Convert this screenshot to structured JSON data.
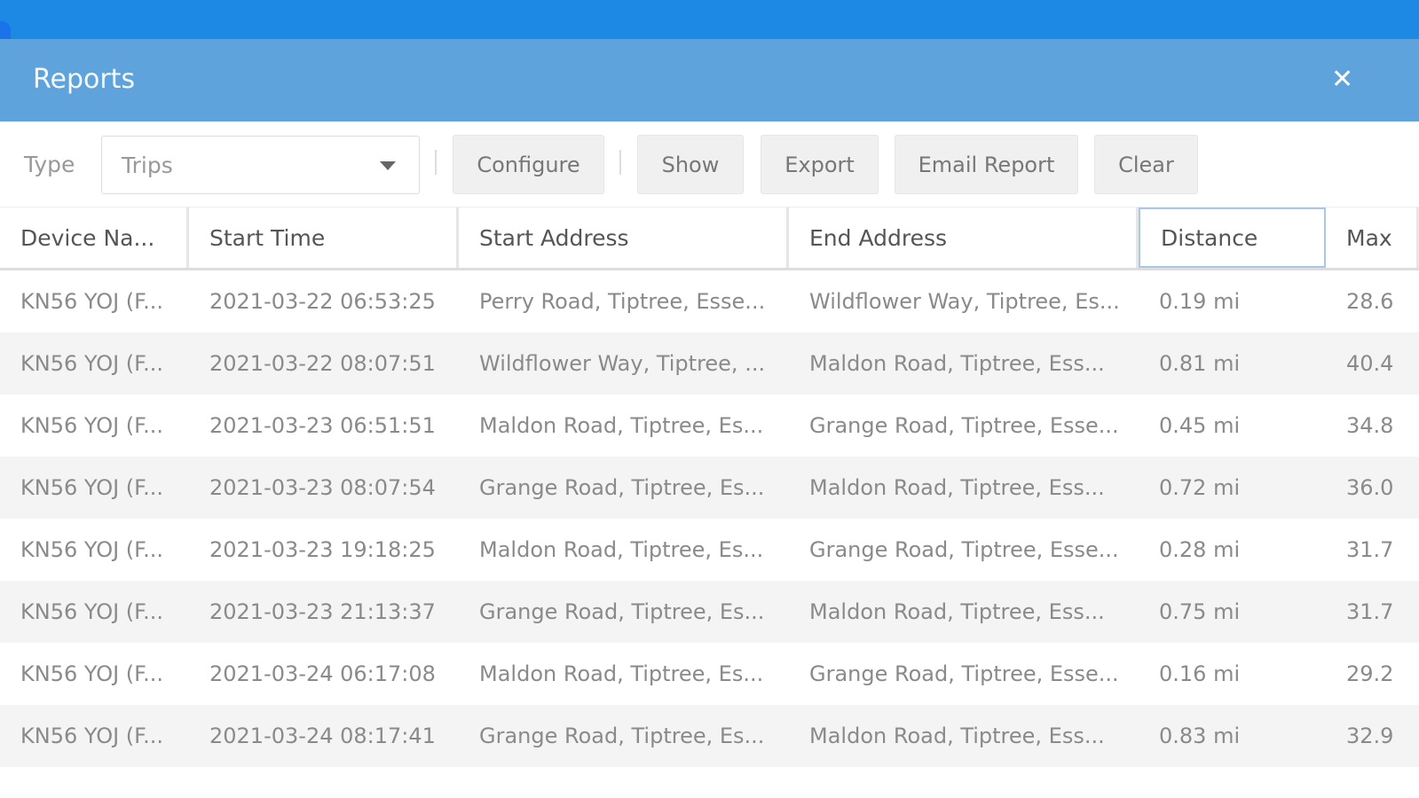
{
  "dialog": {
    "title": "Reports",
    "close_icon": "close-icon"
  },
  "toolbar": {
    "type_label": "Type",
    "type_value": "Trips",
    "configure": "Configure",
    "show": "Show",
    "export": "Export",
    "email_report": "Email Report",
    "clear": "Clear"
  },
  "table": {
    "columns": [
      "Device Na...",
      "Start Time",
      "Start Address",
      "End Address",
      "Distance",
      "Max"
    ],
    "rows": [
      [
        "KN56 YOJ (F...",
        "2021-03-22 06:53:25",
        "Perry Road, Tiptree, Esse...",
        "Wildflower Way, Tiptree, Es...",
        "0.19 mi",
        "28.6"
      ],
      [
        "KN56 YOJ (F...",
        "2021-03-22 08:07:51",
        "Wildflower Way, Tiptree, ...",
        "Maldon Road, Tiptree, Ess...",
        "0.81 mi",
        "40.4"
      ],
      [
        "KN56 YOJ (F...",
        "2021-03-23 06:51:51",
        "Maldon Road, Tiptree, Es...",
        "Grange Road, Tiptree, Esse...",
        "0.45 mi",
        "34.8"
      ],
      [
        "KN56 YOJ (F...",
        "2021-03-23 08:07:54",
        "Grange Road, Tiptree, Es...",
        "Maldon Road, Tiptree, Ess...",
        "0.72 mi",
        "36.0"
      ],
      [
        "KN56 YOJ (F...",
        "2021-03-23 19:18:25",
        "Maldon Road, Tiptree, Es...",
        "Grange Road, Tiptree, Esse...",
        "0.28 mi",
        "31.7"
      ],
      [
        "KN56 YOJ (F...",
        "2021-03-23 21:13:37",
        "Grange Road, Tiptree, Es...",
        "Maldon Road, Tiptree, Ess...",
        "0.75 mi",
        "31.7"
      ],
      [
        "KN56 YOJ (F...",
        "2021-03-24 06:17:08",
        "Maldon Road, Tiptree, Es...",
        "Grange Road, Tiptree, Esse...",
        "0.16 mi",
        "29.2"
      ],
      [
        "KN56 YOJ (F...",
        "2021-03-24 08:17:41",
        "Grange Road, Tiptree, Es...",
        "Maldon Road, Tiptree, Ess...",
        "0.83 mi",
        "32.9"
      ]
    ]
  }
}
